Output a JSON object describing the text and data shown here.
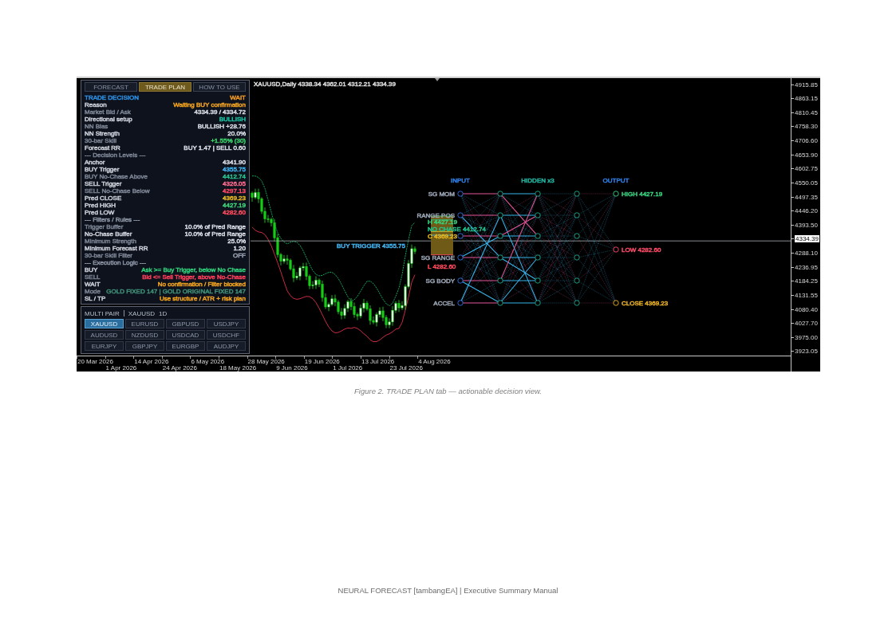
{
  "chart": {
    "title": "XAUUSD,Daily 4338.34 4362.01 4312.21 4334.39",
    "level_labels": [
      {
        "text": "H 4427.19",
        "color": "#35d47e"
      },
      {
        "text": "NO CHASE 4412.74",
        "color": "#22c48e"
      },
      {
        "text": "C 4369.23",
        "color": "#e8b81e"
      },
      {
        "text": "BUY TRIGGER 4355.75",
        "color": "#3fb4f0"
      },
      {
        "text": "L 4282.60",
        "color": "#ff4a5e"
      }
    ],
    "price_axis": [
      {
        "label": "4915.85",
        "kind": "tick"
      },
      {
        "label": "4863.15",
        "kind": "tick"
      },
      {
        "label": "4810.45",
        "kind": "tick"
      },
      {
        "label": "4758.30",
        "kind": "tick"
      },
      {
        "label": "4706.60",
        "kind": "tick"
      },
      {
        "label": "4653.90",
        "kind": "tick"
      },
      {
        "label": "4602.75",
        "kind": "tick"
      },
      {
        "label": "4550.05",
        "kind": "tick"
      },
      {
        "label": "4497.35",
        "kind": "tick"
      },
      {
        "label": "4446.20",
        "kind": "tick"
      },
      {
        "label": "4393.50",
        "kind": "tick"
      },
      {
        "label": "4334.39",
        "kind": "current"
      },
      {
        "label": "4288.10",
        "kind": "tick"
      },
      {
        "label": "4236.95",
        "kind": "tick"
      },
      {
        "label": "4184.25",
        "kind": "tick"
      },
      {
        "label": "4131.55",
        "kind": "tick"
      },
      {
        "label": "4080.40",
        "kind": "tick"
      },
      {
        "label": "4027.70",
        "kind": "tick"
      },
      {
        "label": "3975.00",
        "kind": "tick"
      },
      {
        "label": "3923.05",
        "kind": "tick"
      }
    ],
    "time_axis": [
      "20 Mar 2026",
      "1 Apr 2026",
      "14 Apr 2026",
      "24 Apr 2026",
      "6 May 2026",
      "18 May 2026",
      "28 May 2026",
      "9 Jun 2026",
      "19 Jun 2026",
      "1 Jul 2026",
      "13 Jul 2026",
      "23 Jul 2026",
      "4 Aug 2026"
    ]
  },
  "neural_network": {
    "layers": [
      {
        "title": "INPUT",
        "color": "#2f7fe6"
      },
      {
        "title": "HIDDEN x3",
        "color": "#1fb4a0"
      },
      {
        "title": "OUTPUT",
        "color": "#2f7fe6"
      }
    ],
    "input_labels": [
      "SG MOM",
      "RANGE POS",
      "SG RANGE",
      "SG BODY",
      "ACCEL"
    ],
    "outputs": [
      {
        "label": "HIGH 4427.19",
        "color": "#35d47e"
      },
      {
        "label": "LOW 4282.60",
        "color": "#ff4a68"
      },
      {
        "label": "CLOSE 4369.23",
        "color": "#e8b020"
      }
    ]
  },
  "trade_panel": {
    "tabs": [
      {
        "label": "FORECAST",
        "selected": false
      },
      {
        "label": "TRADE PLAN",
        "selected": true
      },
      {
        "label": "HOW TO USE",
        "selected": false
      }
    ],
    "rows": [
      {
        "label": {
          "text": "TRADE DECISION",
          "color": "#2d8ee0"
        },
        "value": {
          "text": "WAIT",
          "color": "#f39a1e"
        }
      },
      {
        "label": {
          "text": "Reason",
          "color": "#c9cdd6"
        },
        "value": {
          "text": "Waiting BUY confirmation",
          "color": "#f0a21e"
        }
      },
      {
        "label": {
          "text": "Market Bid / Ask",
          "color": "#7a8292"
        },
        "value": {
          "text": "4334.39 / 4334.72",
          "color": "#d8dce4"
        }
      },
      {
        "label": {
          "text": "Directional setup",
          "color": "#c9cdd6"
        },
        "value": {
          "text": "BULLISH",
          "color": "#19c4a4"
        }
      },
      {
        "label": {
          "text": "NN Bias",
          "color": "#7a8292"
        },
        "value": {
          "text": "BULLISH +28.76",
          "color": "#d8dce4"
        }
      },
      {
        "label": {
          "text": "NN Strength",
          "color": "#c9cdd6"
        },
        "value": {
          "text": "20.0%",
          "color": "#d8dce4"
        }
      },
      {
        "label": {
          "text": "30-bar Skill",
          "color": "#7a8292"
        },
        "value": {
          "text": "+1.55% (30)",
          "color": "#3ccf6a"
        }
      },
      {
        "label": {
          "text": "Forecast RR",
          "color": "#c9cdd6"
        },
        "value": {
          "text": "BUY 1.47 | SELL 0.60",
          "color": "#d8dce4"
        }
      },
      {
        "label": {
          "text": "--- Decision Levels ---",
          "color": "#7a8292"
        }
      },
      {
        "label": {
          "text": "Anchor",
          "color": "#c9cdd6"
        },
        "value": {
          "text": "4341.90",
          "color": "#d8dce4"
        }
      },
      {
        "label": {
          "text": "BUY Trigger",
          "color": "#c9cdd6"
        },
        "value": {
          "text": "4355.75",
          "color": "#3fb4f0"
        }
      },
      {
        "label": {
          "text": "BUY No-Chase Above",
          "color": "#7a8292"
        },
        "value": {
          "text": "4412.74",
          "color": "#22c48e"
        }
      },
      {
        "label": {
          "text": "SELL Trigger",
          "color": "#c9cdd6"
        },
        "value": {
          "text": "4326.05",
          "color": "#ff6b8e"
        }
      },
      {
        "label": {
          "text": "SELL No-Chase Below",
          "color": "#7a8292"
        },
        "value": {
          "text": "4297.13",
          "color": "#ff4a68"
        }
      },
      {
        "label": {
          "text": "Pred CLOSE",
          "color": "#c9cdd6"
        },
        "value": {
          "text": "4369.23",
          "color": "#e8b81e"
        }
      },
      {
        "label": {
          "text": "Pred HIGH",
          "color": "#c9cdd6"
        },
        "value": {
          "text": "4427.19",
          "color": "#3ed47a"
        }
      },
      {
        "label": {
          "text": "Pred LOW",
          "color": "#c9cdd6"
        },
        "value": {
          "text": "4282.60",
          "color": "#ff4a5e"
        }
      },
      {
        "label": {
          "text": "--- Filters / Rules ---",
          "color": "#8a92a2"
        }
      },
      {
        "label": {
          "text": "Trigger Buffer",
          "color": "#7a8292"
        },
        "value": {
          "text": "10.0% of Pred Range",
          "color": "#d8dce4"
        }
      },
      {
        "label": {
          "text": "No-Chase Buffer",
          "color": "#c9cdd6"
        },
        "value": {
          "text": "10.0% of Pred Range",
          "color": "#d8dce4"
        }
      },
      {
        "label": {
          "text": "Minimum Strength",
          "color": "#7a8292"
        },
        "value": {
          "text": "25.0%",
          "color": "#d8dce4"
        }
      },
      {
        "label": {
          "text": "Minimum Forecast RR",
          "color": "#c9cdd6"
        },
        "value": {
          "text": "1.20",
          "color": "#d8dce4"
        }
      },
      {
        "label": {
          "text": "30-bar Skill Filter",
          "color": "#7a8292"
        },
        "value": {
          "text": "OFF",
          "color": "#9aa2b2"
        }
      },
      {
        "label": {
          "text": "--- Execution Logic ---",
          "color": "#8a92a2"
        }
      },
      {
        "label": {
          "text": "BUY",
          "color": "#c9cdd6"
        },
        "value": {
          "text": "Ask >= Buy Trigger, below No Chase",
          "color": "#2fcf7a"
        }
      },
      {
        "label": {
          "text": "SELL",
          "color": "#7a8292"
        },
        "value": {
          "text": "Bid <= Sell Trigger, above No-Chase",
          "color": "#ff3f5c"
        }
      },
      {
        "label": {
          "text": "WAIT",
          "color": "#c9cdd6"
        },
        "value": {
          "text": "No confirmation / Filter blocked",
          "color": "#f0a21e"
        }
      },
      {
        "label": {
          "text": "Mode",
          "color": "#7a8292"
        },
        "value": {
          "text": "GOLD FIXED 147 | GOLD ORIGINAL FIXED 147",
          "color": "#3f8f78"
        }
      },
      {
        "label": {
          "text": "SL / TP",
          "color": "#c9cdd6"
        },
        "value": {
          "text": "Use structure / ATR + risk plan",
          "color": "#f0a21e"
        }
      }
    ]
  },
  "multi_pair": {
    "title": "MULTI PAIR",
    "symbol": "XAUUSD",
    "timeframe": "1D",
    "pairs": [
      {
        "label": "XAUUSD",
        "selected": true
      },
      {
        "label": "EURUSD",
        "selected": false
      },
      {
        "label": "GBPUSD",
        "selected": false
      },
      {
        "label": "USDJPY",
        "selected": false
      },
      {
        "label": "AUDUSD",
        "selected": false
      },
      {
        "label": "NZDUSD",
        "selected": false
      },
      {
        "label": "USDCAD",
        "selected": false
      },
      {
        "label": "USDCHF",
        "selected": false
      },
      {
        "label": "EURJPY",
        "selected": false
      },
      {
        "label": "GBPJPY",
        "selected": false
      },
      {
        "label": "EURGBP",
        "selected": false
      },
      {
        "label": "AUDJPY",
        "selected": false
      }
    ]
  },
  "caption": "Figure 2. TRADE PLAN tab — actionable decision view.",
  "footer": "NEURAL FORECAST [tambangEA] | Executive Summary Manual"
}
